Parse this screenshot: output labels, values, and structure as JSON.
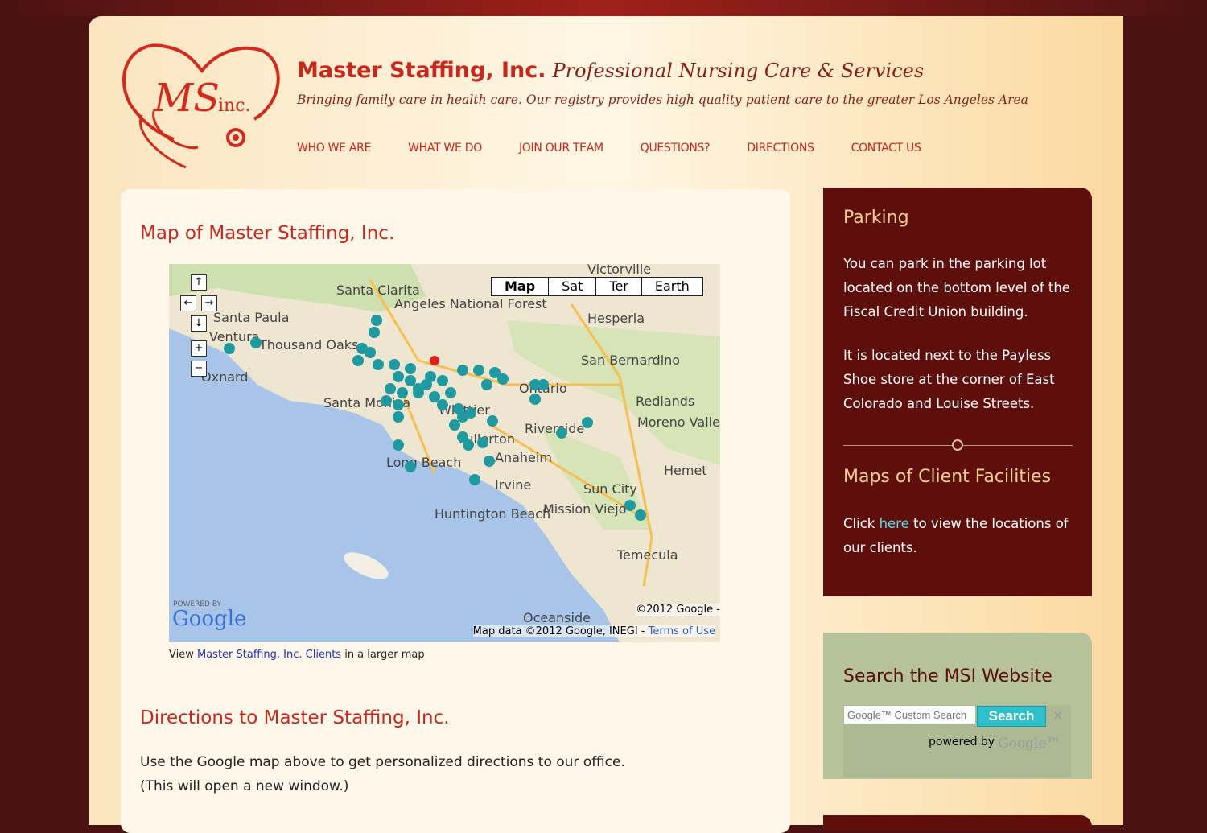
{
  "header": {
    "company": "Master Staffing, Inc.",
    "slogan": "Professional Nursing Care & Services",
    "tagline": "Bringing family care in health care. Our registry provides high quality patient care to the greater Los Angeles Area",
    "logo_text": "MS inc."
  },
  "nav": [
    "WHO WE ARE",
    "WHAT WE DO",
    "JOIN OUR TEAM",
    "QUESTIONS?",
    "DIRECTIONS",
    "CONTACT US"
  ],
  "main": {
    "map_heading": "Map of Master Staffing, Inc.",
    "map": {
      "types": [
        "Map",
        "Sat",
        "Ter",
        "Earth"
      ],
      "selected_type": "Map",
      "cities": [
        "Santa Clarita",
        "Angeles National Forest",
        "Victorville",
        "Hesperia",
        "Santa Paula",
        "Ventura",
        "Thousand Oaks",
        "Oxnard",
        "San Bernardino",
        "Redlands",
        "Ontario",
        "Santa Monica",
        "Whittier",
        "Riverside",
        "Moreno Valley",
        "Fullerton",
        "Long Beach",
        "Anaheim",
        "Hemet",
        "Irvine",
        "Sun City",
        "Mission Viejo",
        "Huntington Beach",
        "Temecula",
        "Oceanside"
      ],
      "powered_by": "POWERED BY",
      "google": "Google",
      "copyright": "©2012 Google -",
      "attribution": "Map data ©2012 Google, INEGI -",
      "terms": "Terms of Use",
      "marker_color": "#1e9aa0"
    },
    "map_link": {
      "prefix": "View",
      "link": "Master Staffing, Inc. Clients",
      "suffix": "in a larger map"
    },
    "directions_heading": "Directions to Master Staffing, Inc.",
    "directions_text_1": "Use the Google map above to get personalized directions to our office.",
    "directions_text_2": "(This will open a new window.)"
  },
  "sidebar": {
    "parking_title": "Parking",
    "parking_p1": "You can park in the parking lot located on the bottom level of the Fiscal Credit Union building.",
    "parking_p2": "It is located next to the Payless Shoe store at the corner of East Colorado and Louise Streets.",
    "facilities_title": "Maps of Client Facilities",
    "facilities_prefix": "Click",
    "facilities_link": "here",
    "facilities_suffix": "to view the locations of our clients.",
    "search_title": "Search the MSI Website",
    "search_placeholder": "Google™ Custom Search",
    "search_button": "Search",
    "powered_by": "powered by",
    "powered_google": "Google™"
  }
}
